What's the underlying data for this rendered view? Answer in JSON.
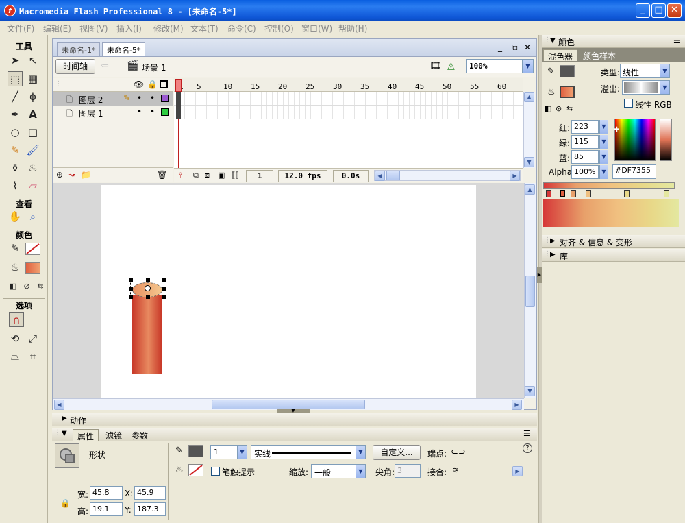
{
  "window": {
    "title": "Macromedia Flash Professional 8 - [未命名-5*]",
    "min_glyph": "_",
    "max_glyph": "□",
    "close_glyph": "✕"
  },
  "menu": [
    "文件(F)",
    "编辑(E)",
    "视图(V)",
    "插入(I)",
    "修改(M)",
    "文本(T)",
    "命令(C)",
    "控制(O)",
    "窗口(W)",
    "帮助(H)"
  ],
  "tools": {
    "header": "工具",
    "view_header": "查看",
    "colors_header": "颜色",
    "options_header": "选项"
  },
  "document": {
    "tabs": [
      "未命名-1*",
      "未命名-5*"
    ],
    "active_tab": 1,
    "timeline_button": "时间轴",
    "scene_label": "场景 1",
    "zoom_value": "100%"
  },
  "timeline": {
    "frame_ticks": [
      "1",
      "5",
      "10",
      "15",
      "20",
      "25",
      "30",
      "35",
      "40",
      "45",
      "50",
      "55",
      "60"
    ],
    "layers": [
      {
        "name": "图层 2",
        "color": "#9b59d0",
        "selected": true
      },
      {
        "name": "图层 1",
        "color": "#2ecc40",
        "selected": false
      }
    ],
    "current_frame": "1",
    "fps": "12.0 fps",
    "elapsed": "0.0s"
  },
  "color_panel": {
    "title": "颜色",
    "tabs": [
      "混色器",
      "颜色样本"
    ],
    "type_label": "类型:",
    "type_value": "线性",
    "overflow_label": "溢出:",
    "linear_rgb_label": "线性 RGB",
    "red_label": "红:",
    "red_value": "223",
    "green_label": "绿:",
    "green_value": "115",
    "blue_label": "蓝:",
    "blue_value": "85",
    "alpha_label": "Alpha:",
    "alpha_value": "100%",
    "hex_value": "#DF7355",
    "gradient_colors": [
      "#d63838",
      "#e8a06a",
      "#f0c080",
      "#e8d888",
      "#e4e8a0"
    ]
  },
  "collapsed_panels": [
    "对齐 & 信息 & 变形",
    "库"
  ],
  "actions_panel": {
    "title": "动作"
  },
  "properties": {
    "tabs": [
      "属性",
      "滤镜",
      "参数"
    ],
    "shape_label": "形状",
    "stroke_height": "1",
    "stroke_style": "实线",
    "custom_button": "自定义...",
    "cap_label": "端点:",
    "hinting_label": "笔触提示",
    "scale_label": "缩放:",
    "scale_value": "一般",
    "miter_label": "尖角:",
    "miter_value": "3",
    "join_label": "接合:",
    "width_label": "宽:",
    "width_value": "45.8",
    "height_label": "高:",
    "height_value": "19.1",
    "x_label": "X:",
    "x_value": "45.9",
    "y_label": "Y:",
    "y_value": "187.3",
    "help_glyph": "?"
  },
  "colors": {
    "accent_blue": "#0a5fe0",
    "stroke_swatch": "#555555",
    "fill_gradient": [
      "#e06040",
      "#f0a070"
    ],
    "shape_fill": [
      "#c83828",
      "#e88a60",
      "#c83828"
    ]
  }
}
